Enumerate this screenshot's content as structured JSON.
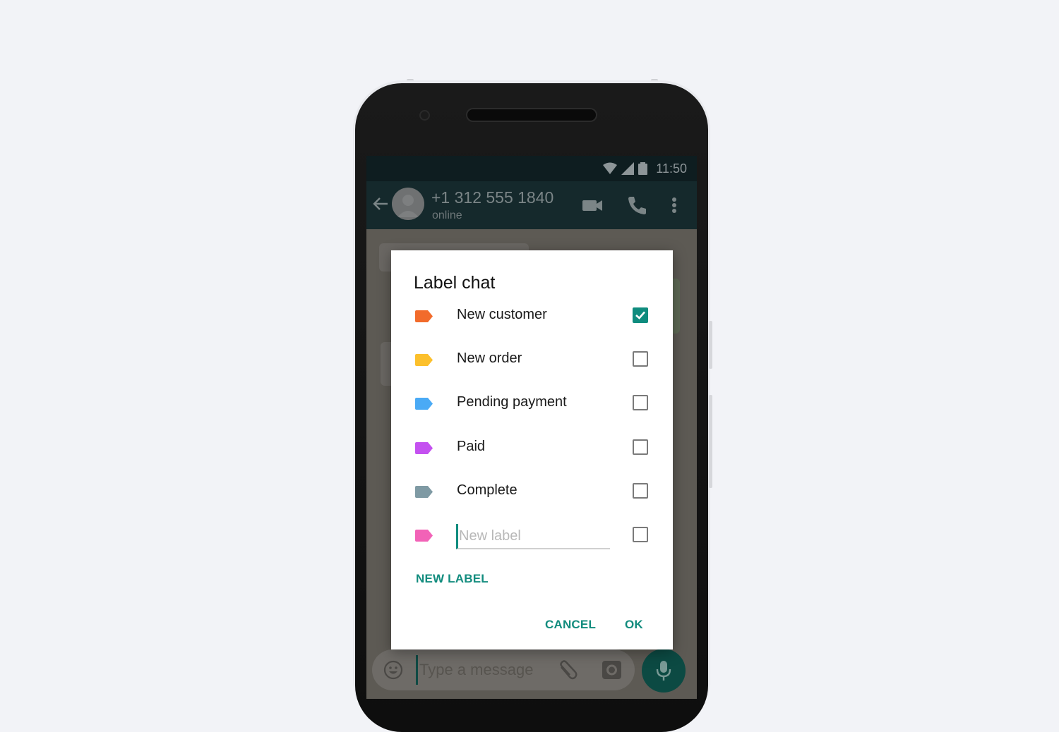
{
  "status_bar": {
    "time": "11:50",
    "icons": [
      "wifi-icon",
      "signal-icon",
      "battery-icon"
    ]
  },
  "app_bar": {
    "contact_name": "+1 312 555 1840",
    "contact_status": "online",
    "icons": [
      "back-arrow-icon",
      "avatar",
      "video-call-icon",
      "phone-call-icon",
      "more-vert-icon"
    ]
  },
  "composer": {
    "placeholder": "Type a message",
    "value": "",
    "icons": [
      "emoji-icon",
      "attach-icon",
      "camera-icon",
      "mic-icon"
    ]
  },
  "dialog": {
    "title": "Label chat",
    "labels": [
      {
        "name": "New customer",
        "color": "#f26b2b",
        "checked": true
      },
      {
        "name": "New order",
        "color": "#fcc02c",
        "checked": false
      },
      {
        "name": "Pending payment",
        "color": "#4aaaf5",
        "checked": false
      },
      {
        "name": "Paid",
        "color": "#c451f0",
        "checked": false
      },
      {
        "name": "Complete",
        "color": "#7f9aa4",
        "checked": false
      }
    ],
    "new_label_row": {
      "placeholder": "New label",
      "value": "",
      "color": "#f262b7",
      "checked": false
    },
    "new_label_button": "NEW LABEL",
    "cancel_button": "CANCEL",
    "ok_button": "OK",
    "accent_color": "#128c7e"
  }
}
